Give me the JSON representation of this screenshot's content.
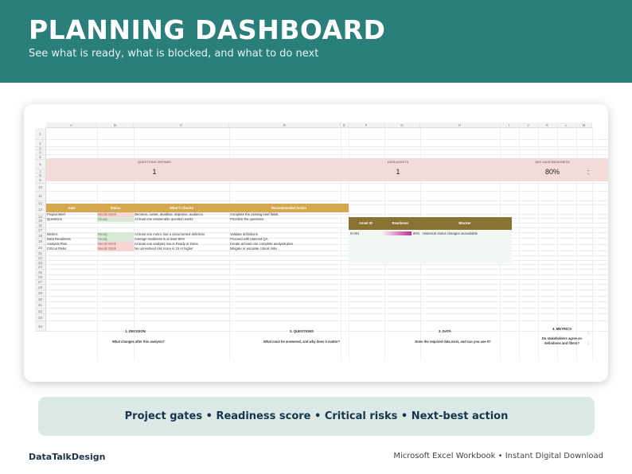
{
  "hero": {
    "title": "PLANNING DASHBOARD",
    "subtitle": "See what is ready, what is blocked, and what to do next"
  },
  "sheet": {
    "columns": [
      "A",
      "B",
      "C",
      "D",
      "E",
      "F",
      "G",
      "H",
      "I",
      "J",
      "K",
      "L",
      "M"
    ],
    "rows": [
      "1",
      "2",
      "3",
      "4",
      "5",
      "6",
      "7",
      "8",
      "9",
      "10",
      "11",
      "12",
      "13",
      "14",
      "15",
      "16",
      "17",
      "18",
      "19",
      "20",
      "21",
      "22",
      "23",
      "24",
      "25",
      "26",
      "27",
      "28",
      "29",
      "30",
      "31",
      "32",
      "33",
      "34"
    ],
    "kpis": [
      {
        "label": "QUESTIONS DEFINED",
        "value": "1"
      },
      {
        "label": "DATA ASSETS",
        "value": "1"
      },
      {
        "label": "AVG DATA READINESS",
        "value": "80%"
      }
    ],
    "kpi_overflow": ":",
    "gates": {
      "headers": [
        "Gate",
        "Status",
        "What it Checks",
        "Recommended Action"
      ],
      "rows": [
        {
          "gate": "Project Brief",
          "status": "Needs Work",
          "checks": "Decision, owner, deadline, objective, audience",
          "action": "Complete the missing brief fields"
        },
        {
          "gate": "Questions",
          "status": "Ready",
          "checks": "At least one answerable question exists",
          "action": "Prioritize the questions"
        },
        {
          "gate": "Metrics",
          "status": "Ready",
          "checks": "At least one metric has a documented definition",
          "action": "Validate definitions"
        },
        {
          "gate": "Data Readiness",
          "status": "Ready",
          "checks": "Average readiness is at least 80%",
          "action": "Proceed with planned QA"
        },
        {
          "gate": "Analysis Plan",
          "status": "Needs Work",
          "checks": "At least one analysis row is Ready or Done",
          "action": "Create at least one complete analysis plan"
        },
        {
          "gate": "Critical Risks",
          "status": "Needs Work",
          "checks": "No unresolved risk score is 15 or higher",
          "action": "Mitigate or escalate critical risks"
        }
      ]
    },
    "assets": {
      "headers": [
        "Asset ID",
        "Readiness",
        "Blocker"
      ],
      "rows": [
        {
          "id": "D-001",
          "readiness": 0.8,
          "readiness_label": "80%",
          "blocker": "Historical status changes unavailable"
        }
      ]
    },
    "steps": [
      {
        "title": "1. DECISION",
        "question": "What changes after this analysis?"
      },
      {
        "title": "2. QUESTIONS",
        "question": "What must be answered, and why does it matter?"
      },
      {
        "title": "3. DATA",
        "question": "Does the required data exist, and can you use it?"
      },
      {
        "title": "4. METRICS",
        "question_line1": "Do stakeholders agree on",
        "question_line2": "definitions and filters?",
        "overflow1": ":",
        "overflow2": ":"
      }
    ]
  },
  "features": "Project gates • Readiness score • Critical risks • Next-best action",
  "footer": {
    "brand": "DataTalkDesign",
    "tagline": "Microsoft Excel Workbook • Instant Digital Download"
  },
  "colors": {
    "hero_bg": "#2a7f7b",
    "kpi_band": "#f5dada",
    "gates_header": "#d4a84e",
    "assets_header": "#8a7232",
    "ready": "#dbe9d8",
    "needs_work": "#f6d5d5",
    "pill_bg": "#dceae7"
  }
}
